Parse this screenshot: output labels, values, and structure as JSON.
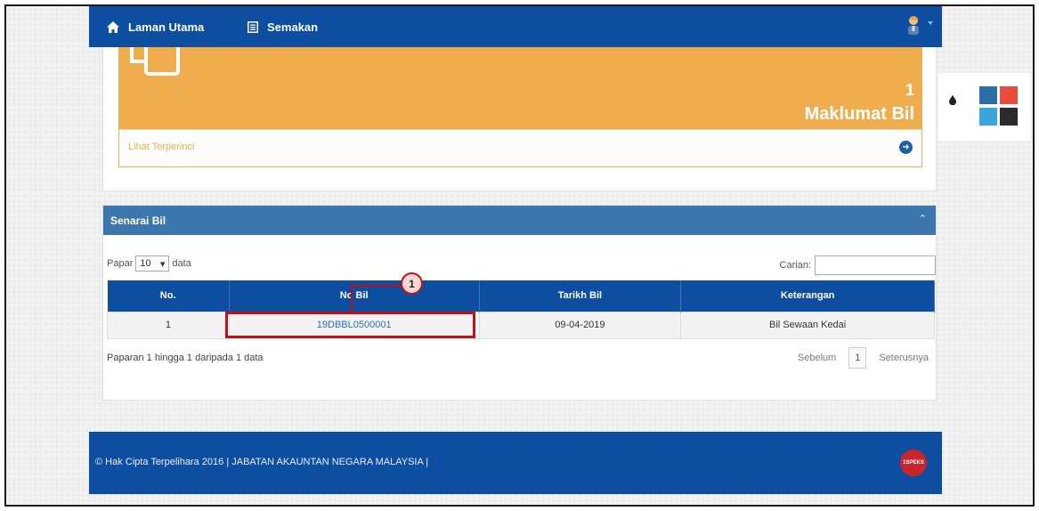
{
  "nav": {
    "home_label": "Laman Utama",
    "semakan_label": "Semakan"
  },
  "stat": {
    "count": "1",
    "label": "Maklumat Bil",
    "link": "Lihat Terperinci",
    "color": "#f0ad4e"
  },
  "panel": {
    "title": "Senarai Bil"
  },
  "table_controls": {
    "show_prefix": "Papar",
    "page_length": "10",
    "show_suffix": "data",
    "search_label": "Carian:",
    "search_value": ""
  },
  "table": {
    "headers": [
      "No.",
      "No Bil",
      "Tarikh Bil",
      "Keterangan"
    ],
    "rows": [
      [
        "1",
        "19DBBL0500001",
        "09-04-2019",
        "Bil Sewaan Kedai"
      ]
    ]
  },
  "pagination": {
    "info": "Paparan 1 hingga 1 daripada 1 data",
    "prev": "Sebelum",
    "current": "1",
    "next": "Seterusnya"
  },
  "annotation": {
    "step": "1"
  },
  "theme_colors": [
    "#2d6da8",
    "#e74c3c",
    "#3aa6dc",
    "#2b2b2b"
  ],
  "footer": {
    "copyright": "© Hak Cipta Terpelihara 2016 | JABATAN AKAUNTAN NEGARA MALAYSIA |",
    "logo_text": "1SPEKS"
  },
  "colors": {
    "primary": "#0d4ea1",
    "panel_header": "#3d76ad",
    "annotation": "#c0111a"
  }
}
